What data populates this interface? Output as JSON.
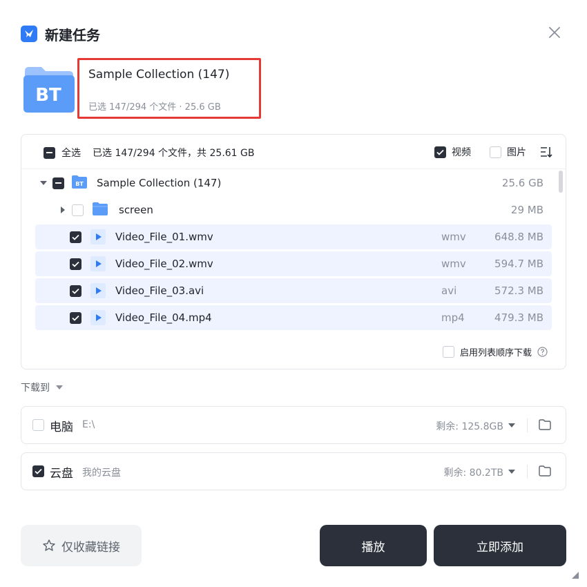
{
  "dialog": {
    "title": "新建任务",
    "close_icon": "close-icon",
    "brand_color": "#2f7bf6"
  },
  "torrent": {
    "icon_label": "BT",
    "name": "Sample Collection (147)",
    "summary": "已选 147/294 个文件 · 25.6 GB"
  },
  "file_list": {
    "select_all_label": "全选",
    "selected_stats": "已选 147/294 个文件，共 25.61 GB",
    "filters": [
      {
        "label": "视频",
        "checked": true
      },
      {
        "label": "图片",
        "checked": false
      }
    ],
    "sort_icon": "sort-icon",
    "root": {
      "name": "Sample Collection (147)",
      "size": "25.6 GB",
      "badge": "BT",
      "state": "partial"
    },
    "folders": [
      {
        "name": "screen",
        "size": "29 MB",
        "checked": false
      }
    ],
    "files": [
      {
        "name": "Video_File_01.wmv",
        "ext": "wmv",
        "size": "648.8 MB",
        "checked": true
      },
      {
        "name": "Video_File_02.wmv",
        "ext": "wmv",
        "size": "594.7 MB",
        "checked": true
      },
      {
        "name": "Video_File_03.avi",
        "ext": "avi",
        "size": "572.3 MB",
        "checked": true
      },
      {
        "name": "Video_File_04.mp4",
        "ext": "mp4",
        "size": "479.3 MB",
        "checked": true
      }
    ],
    "sequential_download_label": "启用列表顺序下载"
  },
  "download_to": {
    "label": "下载到",
    "destinations": [
      {
        "label": "电脑",
        "path": "E:\\",
        "free": "剩余: 125.8GB",
        "checked": false
      },
      {
        "label": "云盘",
        "path": "我的云盘",
        "free": "剩余: 80.2TB",
        "checked": true
      }
    ]
  },
  "buttons": {
    "bookmark_label": "仅收藏链接",
    "play_label": "播放",
    "add_label": "立即添加"
  },
  "colors": {
    "primary_dark": "#2b303b",
    "selected_row": "#eef3ff",
    "highlight_border": "#e53935"
  }
}
